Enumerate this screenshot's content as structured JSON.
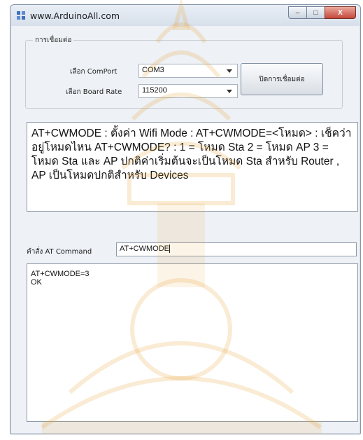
{
  "window": {
    "title": "www.ArduinoAll.com",
    "controls": {
      "minimize": "–",
      "maximize": "□",
      "close": "X"
    }
  },
  "connection": {
    "group_title": "การเชื่อมต่อ",
    "comport_label": "เลือก ComPort",
    "comport_value": "COM3",
    "baud_label": "เลือก Board Rate",
    "baud_value": "115200",
    "connect_button": "ปิดการเชื่อมต่อ"
  },
  "info": {
    "text": "AT+CWMODE : ตั้งค่า Wifi Mode : AT+CWMODE=<โหมด> : เช็คว่าอยู่โหมดไหน AT+CWMODE? : 1 = โหมด Sta 2 = โหมด AP 3 = โหมด Sta และ AP ปกติค่าเริ่มต้นจะเป็นโหมด Sta สำหรับ Router , AP เป็นโหมดปกติสำหรับ Devices"
  },
  "command": {
    "label": "คำสั่ง AT Command",
    "value": "AT+CWMODE"
  },
  "output": {
    "lines": [
      "AT+CWMODE=3",
      "OK"
    ]
  },
  "colors": {
    "watermark": "#e6a23a",
    "window_bg": "#eef1f5",
    "close_button": "#c6483a"
  }
}
